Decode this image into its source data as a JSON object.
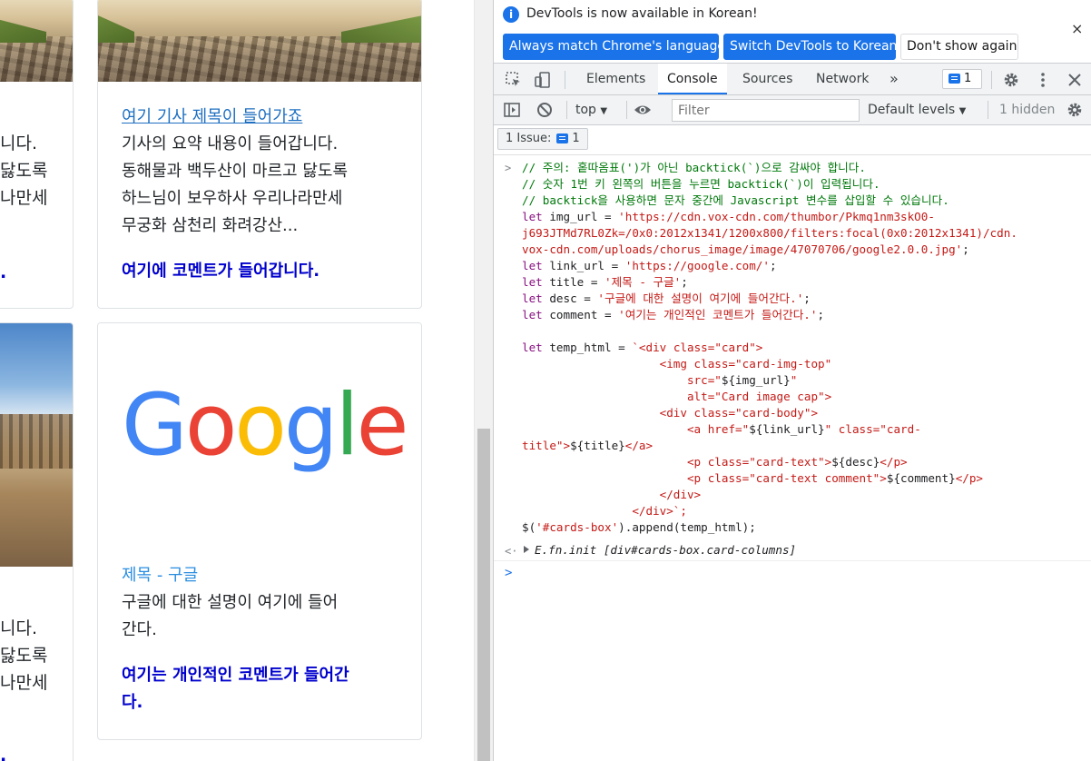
{
  "web": {
    "cards": [
      {
        "title": "여기 기사 제목이 들어가죠",
        "text": [
          "기사의 요약 내용이 들어갑니다.",
          "동해물과 백두산이 마르고 닳도록",
          "하느님이 보우하사 우리나라만세",
          "무궁화 삼천리 화려강산..."
        ],
        "comment": "여기에 코멘트가 들어갑니다."
      },
      {
        "title": "제목 - 구글",
        "text": [
          "구글에 대한 설명이 여기에 들어",
          "간다."
        ],
        "comment": [
          "여기는 개인적인 코멘트가 들어간",
          "다."
        ]
      }
    ],
    "google_logo": {
      "letters": [
        "G",
        "o",
        "o",
        "g",
        "l",
        "e"
      ],
      "colors": [
        "#4285f4",
        "#ea4335",
        "#fbbc05",
        "#4285f4",
        "#34a853",
        "#ea4335"
      ]
    },
    "left_partial": {
      "top": [
        "니다.",
        "닳도록",
        "나만세",
        "."
      ],
      "bottom": [
        "니다.",
        "닳도록",
        "나만세",
        "."
      ]
    }
  },
  "devtools": {
    "infobar": {
      "message": "DevTools is now available in Korean!",
      "btn_match": "Always match Chrome's language",
      "btn_switch": "Switch DevTools to Korean",
      "btn_dont": "Don't show again",
      "close": "×"
    },
    "tabs": [
      "Elements",
      "Console",
      "Sources",
      "Network"
    ],
    "more_tabs": "»",
    "issues_count": "1",
    "toolbar": {
      "context": "top",
      "filter_placeholder": "Filter",
      "levels": "Default levels",
      "hidden": "1 hidden"
    },
    "issue_btn": {
      "label": "1 Issue:",
      "count": "1"
    },
    "console": {
      "result": "E.fn.init [div#cards-box.card-columns]"
    }
  }
}
